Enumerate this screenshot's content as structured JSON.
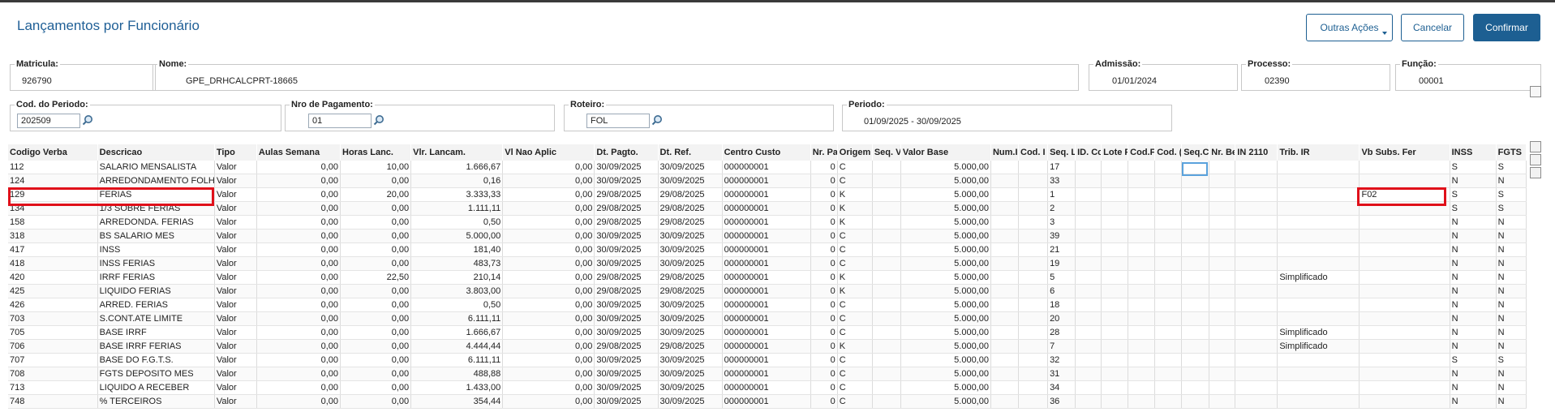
{
  "title": "Lançamentos por Funcionário",
  "buttons": {
    "outras": "Outras Ações",
    "cancelar": "Cancelar",
    "confirmar": "Confirmar"
  },
  "fields": {
    "matricula": {
      "label": "Matricula:",
      "value": "926790"
    },
    "nome": {
      "label": "Nome:",
      "value": "GPE_DRHCALCPRT-18665"
    },
    "admissao": {
      "label": "Admissão:",
      "value": "01/01/2024"
    },
    "processo": {
      "label": "Processo:",
      "value": "02390"
    },
    "funcao": {
      "label": "Função:",
      "value": "00001"
    },
    "periodo_cod": {
      "label": "Cod. do Periodo:",
      "value": "202509"
    },
    "nro_pagamento": {
      "label": "Nro de Pagamento:",
      "value": "01"
    },
    "roteiro": {
      "label": "Roteiro:",
      "value": "FOL"
    },
    "periodo": {
      "label": "Periodo:",
      "value": "01/09/2025 - 30/09/2025"
    }
  },
  "columns": [
    "Codigo Verba",
    "Descricao",
    "Tipo",
    "Aulas Semana",
    "Horas Lanc.",
    "Vlr. Lancam.",
    "Vl Nao Aplic",
    "Dt. Pagto.",
    "Dt. Ref.",
    "Centro Custo",
    "Nr. Pa",
    "Origem",
    "Seq. V",
    "Valor Base",
    "Num.I",
    "Cod. I",
    "Seq. L",
    "ID. Cc",
    "Lote F",
    "Cod.F",
    "Cod. (",
    "Seq.C",
    "Nr. Be",
    "IN 2110",
    "Trib. IR",
    "Vb Subs. Fer",
    "INSS",
    "FGTS"
  ],
  "rows": [
    [
      "112",
      "SALARIO MENSALISTA",
      "Valor",
      "0,00",
      "10,00",
      "1.666,67",
      "0,00",
      "30/09/2025",
      "30/09/2025",
      "000000001",
      "0",
      "C",
      "",
      "5.000,00",
      "",
      "",
      "17",
      "",
      "",
      "",
      "",
      "",
      "",
      "",
      "",
      "",
      "S",
      "S"
    ],
    [
      "124",
      "ARREDONDAMENTO FOLHA",
      "Valor",
      "0,00",
      "0,00",
      "0,16",
      "0,00",
      "30/09/2025",
      "30/09/2025",
      "000000001",
      "0",
      "C",
      "",
      "5.000,00",
      "",
      "",
      "33",
      "",
      "",
      "",
      "",
      "",
      "",
      "",
      "",
      "",
      "N",
      "N"
    ],
    [
      "129",
      "FERIAS",
      "Valor",
      "0,00",
      "20,00",
      "3.333,33",
      "0,00",
      "29/08/2025",
      "29/08/2025",
      "000000001",
      "0",
      "K",
      "",
      "5.000,00",
      "",
      "",
      "1",
      "",
      "",
      "",
      "",
      "",
      "",
      "",
      "",
      "F02",
      "S",
      "S"
    ],
    [
      "134",
      "1/3 SOBRE FERIAS",
      "Valor",
      "0,00",
      "0,00",
      "1.111,11",
      "0,00",
      "29/08/2025",
      "29/08/2025",
      "000000001",
      "0",
      "K",
      "",
      "5.000,00",
      "",
      "",
      "2",
      "",
      "",
      "",
      "",
      "",
      "",
      "",
      "",
      "",
      "S",
      "S"
    ],
    [
      "158",
      "ARREDONDA. FERIAS",
      "Valor",
      "0,00",
      "0,00",
      "0,50",
      "0,00",
      "29/08/2025",
      "29/08/2025",
      "000000001",
      "0",
      "K",
      "",
      "5.000,00",
      "",
      "",
      "3",
      "",
      "",
      "",
      "",
      "",
      "",
      "",
      "",
      "",
      "N",
      "N"
    ],
    [
      "318",
      "BS SALARIO MES",
      "Valor",
      "0,00",
      "0,00",
      "5.000,00",
      "0,00",
      "30/09/2025",
      "30/09/2025",
      "000000001",
      "0",
      "C",
      "",
      "5.000,00",
      "",
      "",
      "39",
      "",
      "",
      "",
      "",
      "",
      "",
      "",
      "",
      "",
      "N",
      "N"
    ],
    [
      "417",
      "INSS",
      "Valor",
      "0,00",
      "0,00",
      "181,40",
      "0,00",
      "30/09/2025",
      "30/09/2025",
      "000000001",
      "0",
      "C",
      "",
      "5.000,00",
      "",
      "",
      "21",
      "",
      "",
      "",
      "",
      "",
      "",
      "",
      "",
      "",
      "N",
      "N"
    ],
    [
      "418",
      "INSS FERIAS",
      "Valor",
      "0,00",
      "0,00",
      "483,73",
      "0,00",
      "30/09/2025",
      "30/09/2025",
      "000000001",
      "0",
      "C",
      "",
      "5.000,00",
      "",
      "",
      "19",
      "",
      "",
      "",
      "",
      "",
      "",
      "",
      "",
      "",
      "N",
      "N"
    ],
    [
      "420",
      "IRRF FERIAS",
      "Valor",
      "0,00",
      "22,50",
      "210,14",
      "0,00",
      "29/08/2025",
      "29/08/2025",
      "000000001",
      "0",
      "K",
      "",
      "5.000,00",
      "",
      "",
      "5",
      "",
      "",
      "",
      "",
      "",
      "",
      "",
      "Simplificado",
      "",
      "N",
      "N"
    ],
    [
      "425",
      "LIQUIDO FERIAS",
      "Valor",
      "0,00",
      "0,00",
      "3.803,00",
      "0,00",
      "29/08/2025",
      "29/08/2025",
      "000000001",
      "0",
      "K",
      "",
      "5.000,00",
      "",
      "",
      "6",
      "",
      "",
      "",
      "",
      "",
      "",
      "",
      "",
      "",
      "N",
      "N"
    ],
    [
      "426",
      "ARRED. FERIAS",
      "Valor",
      "0,00",
      "0,00",
      "0,50",
      "0,00",
      "30/09/2025",
      "30/09/2025",
      "000000001",
      "0",
      "C",
      "",
      "5.000,00",
      "",
      "",
      "18",
      "",
      "",
      "",
      "",
      "",
      "",
      "",
      "",
      "",
      "N",
      "N"
    ],
    [
      "703",
      "S.CONT.ATE LIMITE",
      "Valor",
      "0,00",
      "0,00",
      "6.111,11",
      "0,00",
      "30/09/2025",
      "30/09/2025",
      "000000001",
      "0",
      "C",
      "",
      "5.000,00",
      "",
      "",
      "20",
      "",
      "",
      "",
      "",
      "",
      "",
      "",
      "",
      "",
      "N",
      "N"
    ],
    [
      "705",
      "BASE IRRF",
      "Valor",
      "0,00",
      "0,00",
      "1.666,67",
      "0,00",
      "30/09/2025",
      "30/09/2025",
      "000000001",
      "0",
      "C",
      "",
      "5.000,00",
      "",
      "",
      "28",
      "",
      "",
      "",
      "",
      "",
      "",
      "",
      "Simplificado",
      "",
      "N",
      "N"
    ],
    [
      "706",
      "BASE IRRF FERIAS",
      "Valor",
      "0,00",
      "0,00",
      "4.444,44",
      "0,00",
      "29/08/2025",
      "29/08/2025",
      "000000001",
      "0",
      "K",
      "",
      "5.000,00",
      "",
      "",
      "7",
      "",
      "",
      "",
      "",
      "",
      "",
      "",
      "Simplificado",
      "",
      "N",
      "N"
    ],
    [
      "707",
      "BASE DO F.G.T.S.",
      "Valor",
      "0,00",
      "0,00",
      "6.111,11",
      "0,00",
      "30/09/2025",
      "30/09/2025",
      "000000001",
      "0",
      "C",
      "",
      "5.000,00",
      "",
      "",
      "32",
      "",
      "",
      "",
      "",
      "",
      "",
      "",
      "",
      "",
      "S",
      "S"
    ],
    [
      "708",
      "FGTS DEPOSITO MES",
      "Valor",
      "0,00",
      "0,00",
      "488,88",
      "0,00",
      "30/09/2025",
      "30/09/2025",
      "000000001",
      "0",
      "C",
      "",
      "5.000,00",
      "",
      "",
      "31",
      "",
      "",
      "",
      "",
      "",
      "",
      "",
      "",
      "",
      "N",
      "N"
    ],
    [
      "713",
      "LIQUIDO A RECEBER",
      "Valor",
      "0,00",
      "0,00",
      "1.433,00",
      "0,00",
      "30/09/2025",
      "30/09/2025",
      "000000001",
      "0",
      "C",
      "",
      "5.000,00",
      "",
      "",
      "34",
      "",
      "",
      "",
      "",
      "",
      "",
      "",
      "",
      "",
      "N",
      "N"
    ],
    [
      "748",
      "% TERCEIROS",
      "Valor",
      "0,00",
      "0,00",
      "354,44",
      "0,00",
      "30/09/2025",
      "30/09/2025",
      "000000001",
      "0",
      "C",
      "",
      "5.000,00",
      "",
      "",
      "36",
      "",
      "",
      "",
      "",
      "",
      "",
      "",
      "",
      "",
      "N",
      "N"
    ]
  ]
}
